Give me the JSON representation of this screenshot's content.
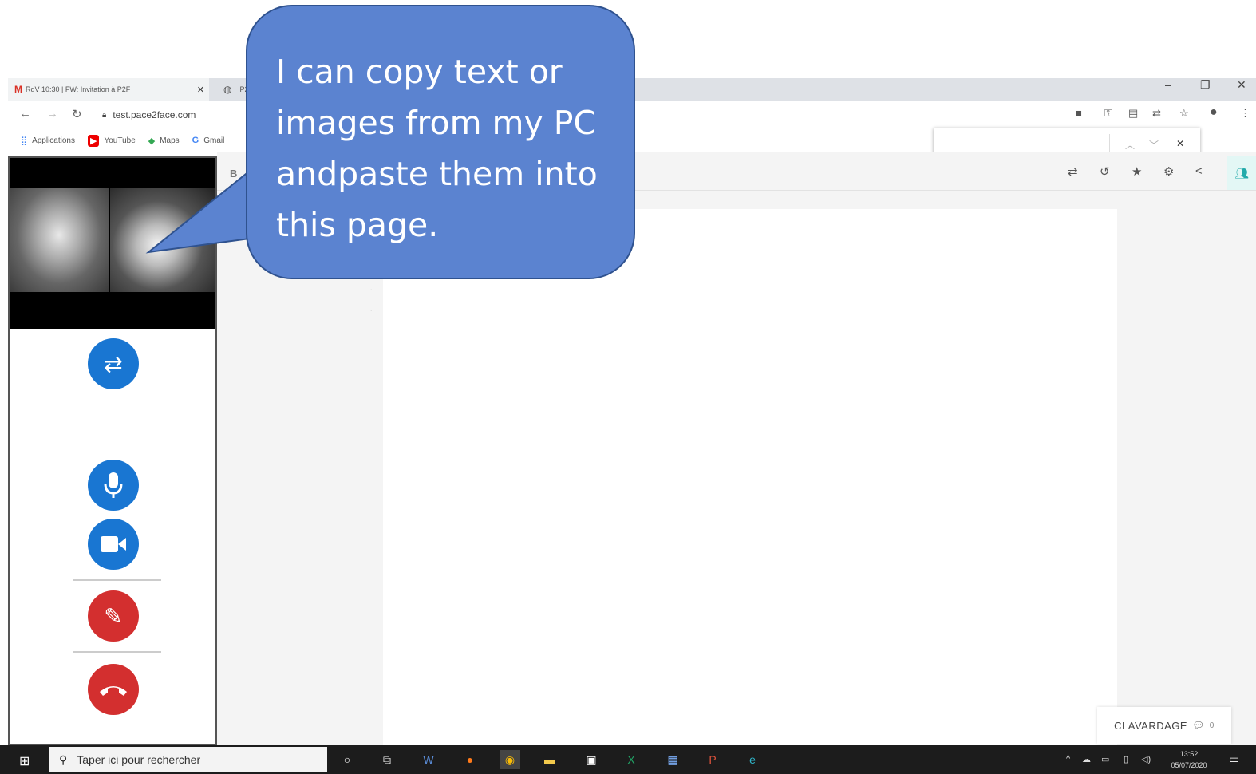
{
  "browser": {
    "tabs": [
      {
        "label": "RdV 10:30 | FW: Invitation à P2F"
      },
      {
        "label": "P2F client"
      }
    ],
    "url": "test.pace2face.com",
    "bookmarks": [
      {
        "label": "Applications",
        "icon": "apps-grid-icon"
      },
      {
        "label": "YouTube",
        "icon": "youtube-icon"
      },
      {
        "label": "Maps",
        "icon": "maps-icon"
      },
      {
        "label": "Gmail",
        "icon": "gmail-icon"
      }
    ]
  },
  "callout": {
    "text": "I can copy text or images from my PC andpaste them into this page."
  },
  "chat": {
    "label": "CLAVARDAGE",
    "count": "0"
  },
  "taskbar": {
    "search_placeholder": "Taper ici pour rechercher",
    "time": "13:52",
    "date": "05/07/2020"
  },
  "colors": {
    "callout_fill": "#5b83d0",
    "callout_border": "#2f528f",
    "control_blue": "#1976d2",
    "control_red": "#d32f2f"
  }
}
